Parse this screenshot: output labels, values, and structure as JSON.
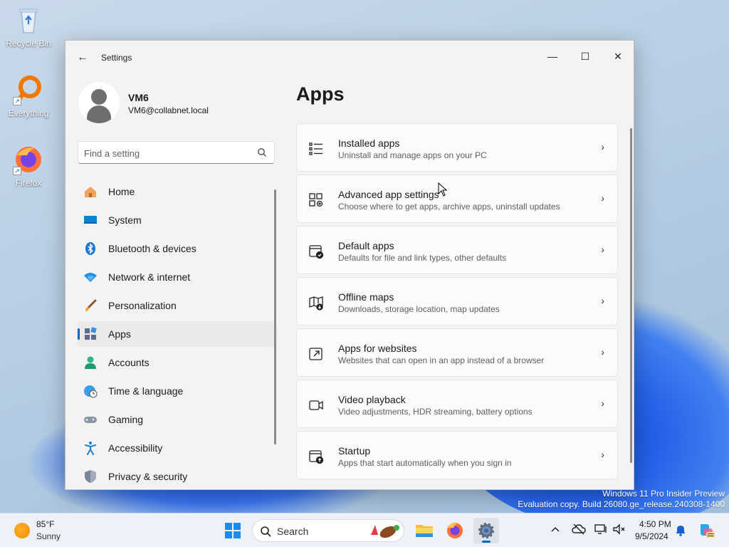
{
  "desktop": {
    "icons": [
      {
        "label": "Recycle Bin",
        "icon": "recycle-bin-icon"
      },
      {
        "label": "Everything",
        "icon": "everything-icon"
      },
      {
        "label": "Firefox",
        "icon": "firefox-icon"
      }
    ],
    "watermark": {
      "line1": "Windows 11 Pro Insider Preview",
      "line2": "Evaluation copy. Build 26080.ge_release.240308-1400"
    }
  },
  "window": {
    "title": "Settings",
    "controls": {
      "minimize": "—",
      "maximize": "☐",
      "close": "✕"
    },
    "back_glyph": "←"
  },
  "profile": {
    "name": "VM6",
    "email": "VM6@collabnet.local"
  },
  "search": {
    "placeholder": "Find a setting",
    "value": ""
  },
  "nav": {
    "items": [
      {
        "label": "Home",
        "icon": "home-icon",
        "selected": false
      },
      {
        "label": "System",
        "icon": "system-monitor-icon",
        "selected": false
      },
      {
        "label": "Bluetooth & devices",
        "icon": "bluetooth-icon",
        "selected": false
      },
      {
        "label": "Network & internet",
        "icon": "wifi-icon",
        "selected": false
      },
      {
        "label": "Personalization",
        "icon": "brush-icon",
        "selected": false
      },
      {
        "label": "Apps",
        "icon": "apps-icon",
        "selected": true
      },
      {
        "label": "Accounts",
        "icon": "accounts-icon",
        "selected": false
      },
      {
        "label": "Time & language",
        "icon": "globe-clock-icon",
        "selected": false
      },
      {
        "label": "Gaming",
        "icon": "gamepad-icon",
        "selected": false
      },
      {
        "label": "Accessibility",
        "icon": "accessibility-icon",
        "selected": false
      },
      {
        "label": "Privacy & security",
        "icon": "shield-icon",
        "selected": false
      }
    ]
  },
  "main": {
    "title": "Apps",
    "cards": [
      {
        "title": "Installed apps",
        "desc": "Uninstall and manage apps on your PC",
        "icon": "list-icon"
      },
      {
        "title": "Advanced app settings",
        "desc": "Choose where to get apps, archive apps, uninstall updates",
        "icon": "app-settings-icon"
      },
      {
        "title": "Default apps",
        "desc": "Defaults for file and link types, other defaults",
        "icon": "default-apps-icon"
      },
      {
        "title": "Offline maps",
        "desc": "Downloads, storage location, map updates",
        "icon": "offline-map-icon"
      },
      {
        "title": "Apps for websites",
        "desc": "Websites that can open in an app instead of a browser",
        "icon": "open-external-icon"
      },
      {
        "title": "Video playback",
        "desc": "Video adjustments, HDR streaming, battery options",
        "icon": "video-icon"
      },
      {
        "title": "Startup",
        "desc": "Apps that start automatically when you sign in",
        "icon": "startup-icon"
      }
    ],
    "chevron": "›"
  },
  "taskbar": {
    "weather": {
      "temp": "85°F",
      "condition": "Sunny"
    },
    "search_label": "Search",
    "apps": [
      "start-icon",
      "file-explorer-icon",
      "firefox-icon",
      "settings-gear-icon"
    ],
    "tray": {
      "time": "4:50 PM",
      "date": "9/5/2024"
    },
    "colors": {
      "accent": "#0067c0"
    }
  }
}
